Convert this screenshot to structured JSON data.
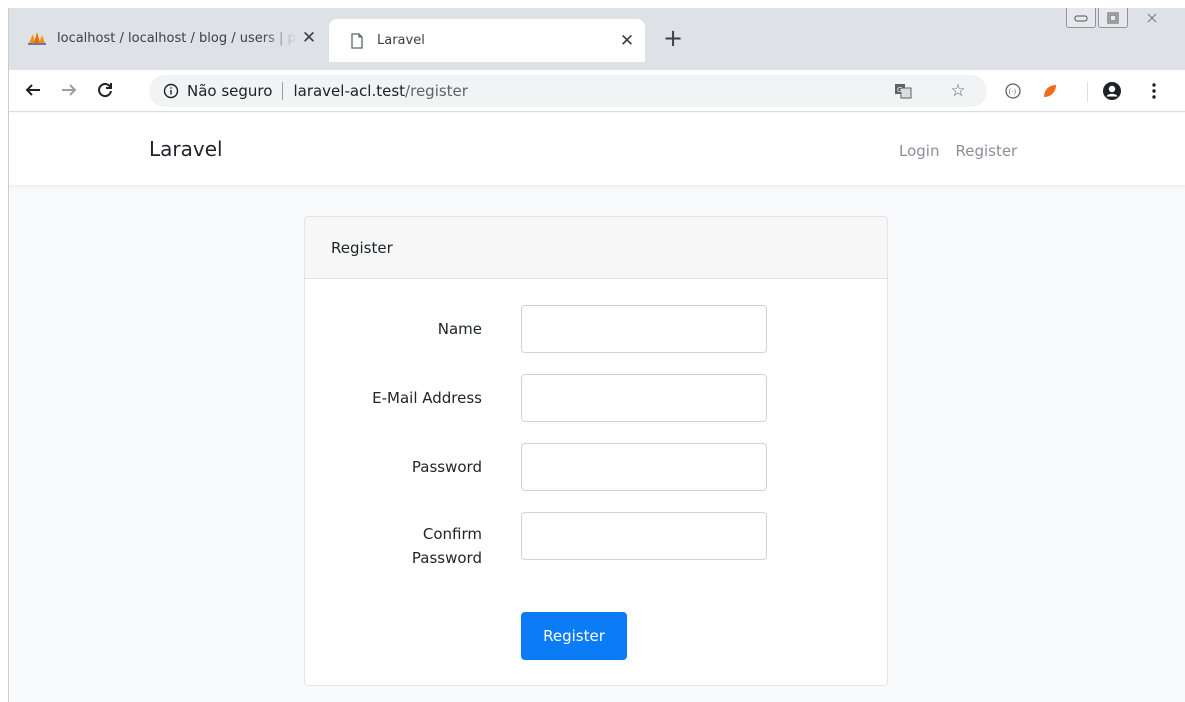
{
  "browser": {
    "tabs": [
      {
        "title": "localhost / localhost / blog / users | phpMyAdmin",
        "active": false
      },
      {
        "title": "Laravel",
        "active": true
      }
    ],
    "address": {
      "security_label": "Não seguro",
      "host": "laravel-acl.test",
      "path": "/register"
    }
  },
  "navbar": {
    "brand": "Laravel",
    "links": [
      "Login",
      "Register"
    ]
  },
  "card": {
    "header": "Register",
    "fields": [
      {
        "label": "Name",
        "value": ""
      },
      {
        "label": "E-Mail Address",
        "value": ""
      },
      {
        "label": "Password",
        "value": ""
      },
      {
        "label_line1": "Confirm",
        "label_line2": "Password",
        "value": ""
      }
    ],
    "submit_label": "Register"
  },
  "colors": {
    "primary": "#0b7cf5",
    "page_bg": "#f8fafc",
    "tabstrip": "#dee1e6"
  }
}
